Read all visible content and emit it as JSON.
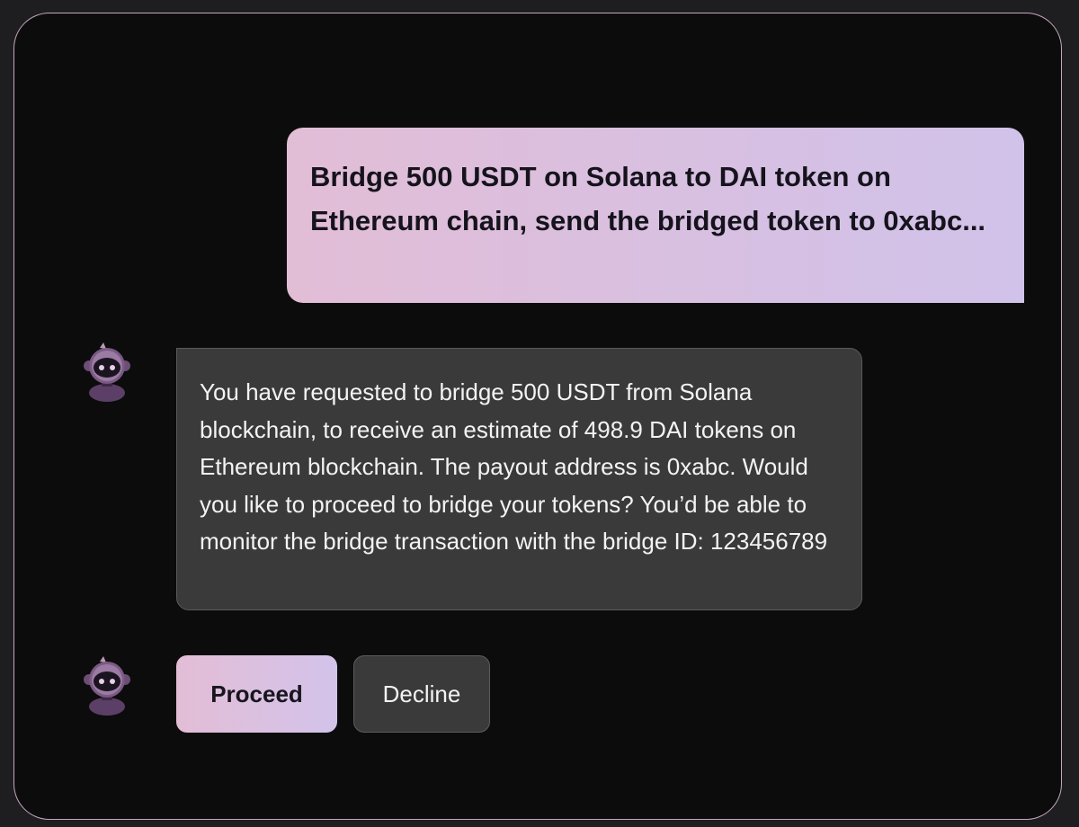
{
  "conversation": {
    "user_message": "Bridge 500 USDT on Solana to DAI token on Ethereum chain, send the bridged token to 0xabc...",
    "bot_message": "You have requested to bridge 500 USDT from Solana blockchain, to receive an estimate of 498.9 DAI tokens on Ethereum blockchain. The payout address is 0xabc. Would you like to proceed to bridge your tokens? You’d be able to monitor the bridge transaction with the bridge ID: 123456789"
  },
  "actions": {
    "proceed_label": "Proceed",
    "decline_label": "Decline"
  },
  "avatar": {
    "icon": "robot-icon"
  },
  "colors": {
    "panel_border": "#c7a6c0",
    "user_bubble_start": "#e2bdd6",
    "user_bubble_end": "#d1c2ea",
    "bot_bubble": "#3a3a3a",
    "background": "#0c0c0c"
  }
}
